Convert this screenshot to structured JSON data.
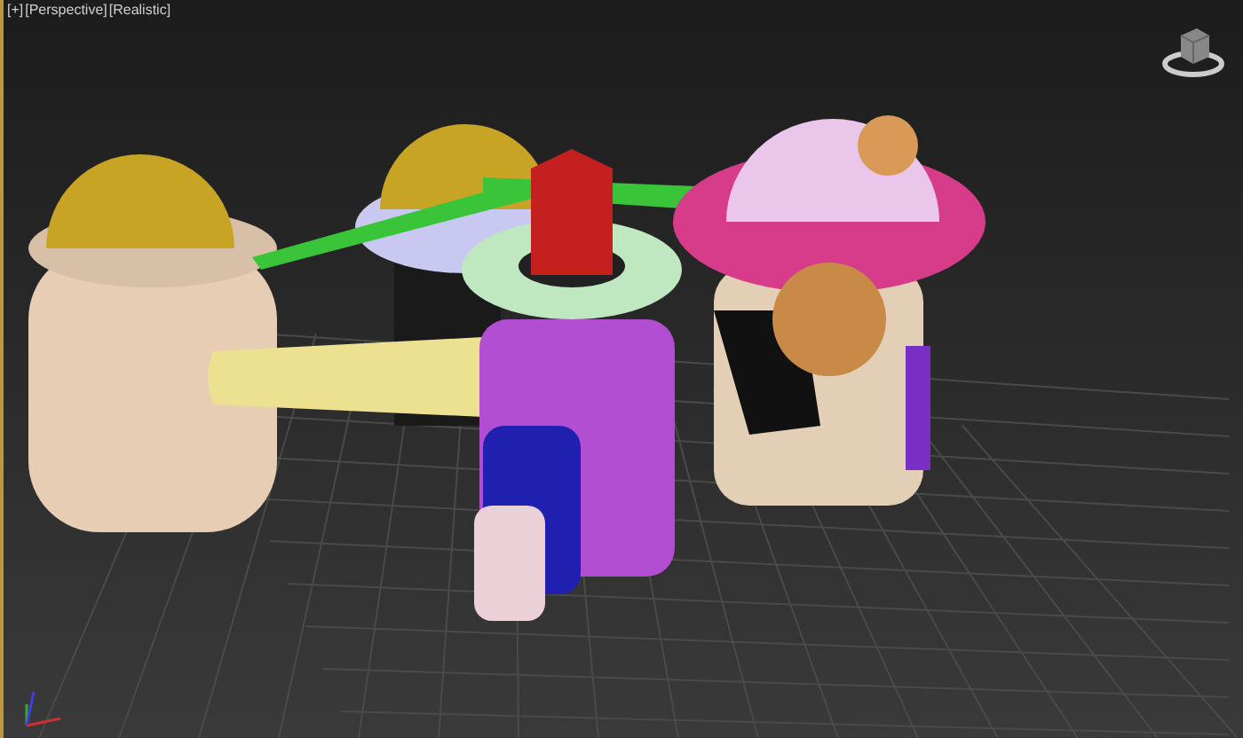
{
  "viewport": {
    "labels": [
      "[+]",
      "[Perspective]",
      "[Realistic]"
    ]
  }
}
